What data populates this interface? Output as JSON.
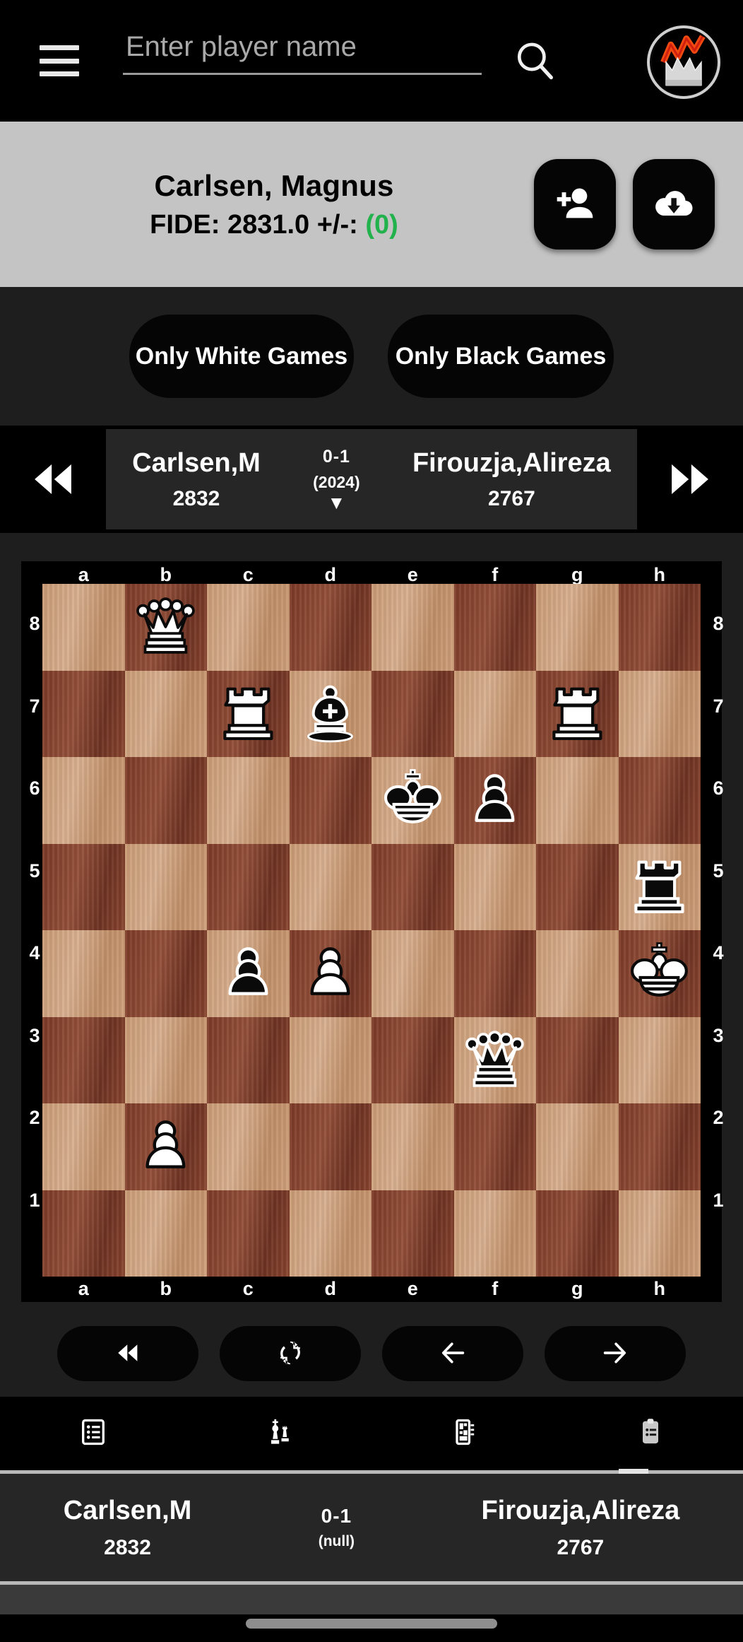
{
  "appbar": {
    "menu_icon": "hamburger-menu-icon",
    "search_placeholder": "Enter player name",
    "search_value": "",
    "search_icon": "search-icon",
    "avatar_icon": "crown-logo-avatar"
  },
  "player_header": {
    "name": "Carlsen, Magnus",
    "rating_label": "FIDE: 2831.0  +/-:",
    "rating_delta": "(0)",
    "delta_color": "#21b24b",
    "add_player_icon": "add-person-icon",
    "download_icon": "cloud-download-icon"
  },
  "filters": {
    "white_label": "Only White Games",
    "black_label": "Only Black Games"
  },
  "game_strip": {
    "prev_icon": "skip-back-icon",
    "next_icon": "skip-forward-icon",
    "white_name": "Carlsen,M",
    "white_elo": "2832",
    "score": "0-1",
    "year": "(2024)",
    "caret": "▼",
    "black_name": "Firouzja,Alireza",
    "black_elo": "2767"
  },
  "board": {
    "files": [
      "a",
      "b",
      "c",
      "d",
      "e",
      "f",
      "g",
      "h"
    ],
    "ranks": [
      "8",
      "7",
      "6",
      "5",
      "4",
      "3",
      "2",
      "1"
    ],
    "orientation": "white-bottom",
    "light_square_color": "#cfa07c",
    "dark_square_color": "#8b4a32",
    "position": [
      [
        "",
        "wQ",
        "",
        "",
        "",
        "",
        "",
        ""
      ],
      [
        "",
        "",
        "wR",
        "bB",
        "",
        "",
        "wR",
        ""
      ],
      [
        "",
        "",
        "",
        "",
        "bK",
        "bP",
        "",
        ""
      ],
      [
        "",
        "",
        "",
        "",
        "",
        "",
        "",
        "bR"
      ],
      [
        "",
        "",
        "bP",
        "wP",
        "",
        "",
        "",
        "wK"
      ],
      [
        "",
        "",
        "",
        "",
        "",
        "bQ",
        "",
        ""
      ],
      [
        "",
        "wP",
        "",
        "",
        "",
        "",
        "",
        ""
      ],
      [
        "",
        "",
        "",
        "",
        "",
        "",
        "",
        ""
      ]
    ]
  },
  "board_controls": [
    {
      "name": "rewind-to-start-button",
      "icon": "double-left-arrow-icon"
    },
    {
      "name": "flip-board-button",
      "icon": "refresh-flip-icon"
    },
    {
      "name": "previous-move-button",
      "icon": "left-arrow-icon"
    },
    {
      "name": "next-move-button",
      "icon": "right-arrow-icon"
    }
  ],
  "tabs": [
    {
      "name": "tab-moves-list",
      "icon": "list-icon"
    },
    {
      "name": "tab-pieces",
      "icon": "chess-pieces-icon"
    },
    {
      "name": "tab-board-panel",
      "icon": "board-panel-icon"
    },
    {
      "name": "tab-notes",
      "icon": "clipboard-icon"
    }
  ],
  "footer": {
    "white_name": "Carlsen,M",
    "white_elo": "2832",
    "score": "0-1",
    "sub": "(null)",
    "black_name": "Firouzja,Alireza",
    "black_elo": "2767"
  }
}
